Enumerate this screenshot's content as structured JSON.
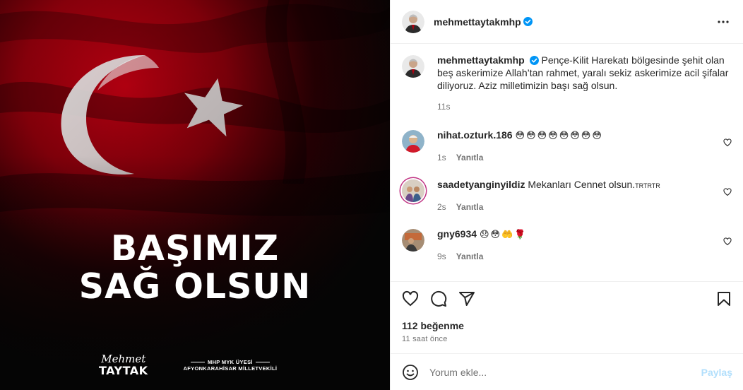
{
  "image": {
    "headline_line1": "BAŞIMIZ",
    "headline_line2": "SAĞ OLSUN",
    "signature_script": "Mehmet",
    "signature_surname": "TAYTAK",
    "signature_title1": "MHP MYK ÜYESİ",
    "signature_title2": "AFYONKARAHİSAR MİLLETVEKİLİ"
  },
  "header": {
    "username": "mehmettaytakmhp",
    "verified_icon": "verified-badge-icon",
    "more_icon": "more-options-icon"
  },
  "caption": {
    "username": "mehmettaytakmhp",
    "text": "Pençe-Kilit Harekatı bölgesinde şehit olan beş askerimize Allah’tan rahmet, yaralı sekiz askerimize acil şifalar diliyoruz. Aziz milletimizin başı sağ olsun.",
    "age": "11s"
  },
  "comments": [
    {
      "username": "nihat.ozturk.186",
      "text": "😳😳😳😳😳😳😳😳",
      "age": "1s",
      "reply_label": "Yanıtla"
    },
    {
      "username": "saadetyanginyildiz",
      "text": "Mekanları Cennet olsun.",
      "suffix": "TRTRTR",
      "age": "2s",
      "reply_label": "Yanıtla"
    },
    {
      "username": "gny6934",
      "text": "😞😳🤲🌹",
      "age": "9s",
      "reply_label": "Yanıtla"
    }
  ],
  "actions": {
    "icons": [
      "heart-icon",
      "comment-icon",
      "share-icon",
      "bookmark-icon"
    ]
  },
  "likes": "112 beğenme",
  "timestamp": "11 saat önce",
  "add_comment": {
    "placeholder": "Yorum ekle...",
    "post_label": "Paylaş"
  },
  "colors": {
    "verified": "#0095f6",
    "post_button_disabled": "#b2dffc",
    "flag_red": "#a3000c"
  }
}
